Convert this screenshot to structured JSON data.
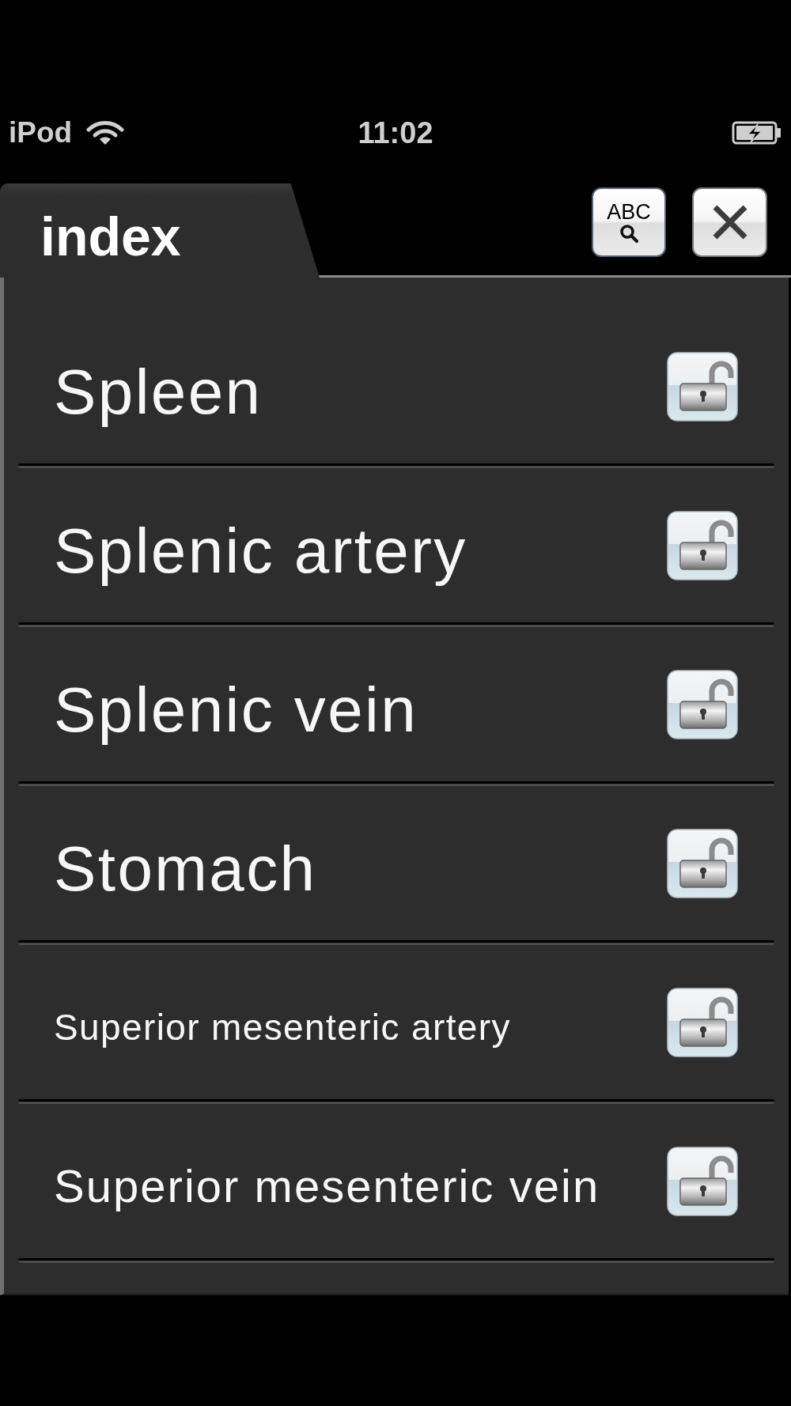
{
  "status_bar": {
    "carrier": "iPod",
    "time": "11:02"
  },
  "header": {
    "title": "index",
    "search_button": {
      "label": "ABC"
    }
  },
  "items": [
    {
      "name": "Spleen",
      "locked": false
    },
    {
      "name": "Splenic artery",
      "locked": false
    },
    {
      "name": "Splenic vein",
      "locked": false
    },
    {
      "name": "Stomach",
      "locked": false
    },
    {
      "name": "Superior mesenteric artery",
      "locked": false
    },
    {
      "name": "Superior mesenteric vein",
      "locked": false
    }
  ]
}
